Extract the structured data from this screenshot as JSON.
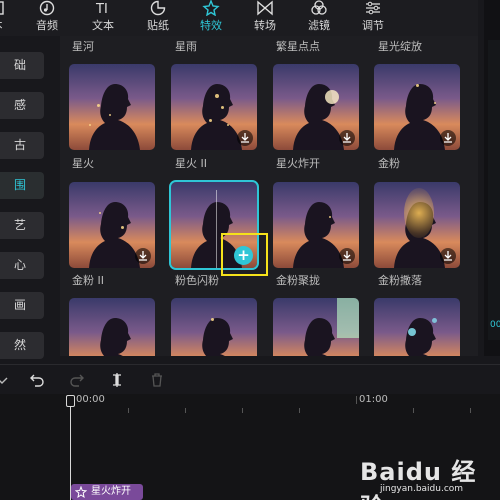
{
  "toolbar": {
    "tabs": [
      {
        "label": "本",
        "icon": "text-tab-icon"
      },
      {
        "label": "音频",
        "icon": "audio-icon"
      },
      {
        "label": "文本",
        "icon": "text-icon"
      },
      {
        "label": "贴纸",
        "icon": "sticker-icon"
      },
      {
        "label": "特效",
        "icon": "effects-icon",
        "active": true
      },
      {
        "label": "转场",
        "icon": "transition-icon"
      },
      {
        "label": "滤镜",
        "icon": "filter-icon"
      },
      {
        "label": "调节",
        "icon": "adjust-icon"
      }
    ]
  },
  "sidebar": {
    "items": [
      {
        "label": "础"
      },
      {
        "label": "感"
      },
      {
        "label": "古"
      },
      {
        "label": "围",
        "active": true
      },
      {
        "label": "艺"
      },
      {
        "label": "心"
      },
      {
        "label": "画"
      },
      {
        "label": "然"
      }
    ]
  },
  "effects": {
    "row0_names": [
      "星河",
      "星雨",
      "繁星点点",
      "星光绽放"
    ],
    "row1_names": [
      "星火",
      "星火 II",
      "星火炸开",
      "金粉"
    ],
    "row2_names": [
      "金粉 II",
      "粉色闪粉",
      "金粉聚拢",
      "金粉撒落"
    ],
    "add_button_label": "+"
  },
  "preview": {
    "time": "00"
  },
  "timeline": {
    "time_start": "00:00",
    "time_mark": "01:00",
    "clip_label": "星火炸开"
  },
  "watermark": {
    "text": "Baidu 经验",
    "url": "jingyan.baidu.com"
  },
  "colors": {
    "accent": "#2fc6d6",
    "highlight": "#f5e21b",
    "clip": "#7a4a9a"
  }
}
